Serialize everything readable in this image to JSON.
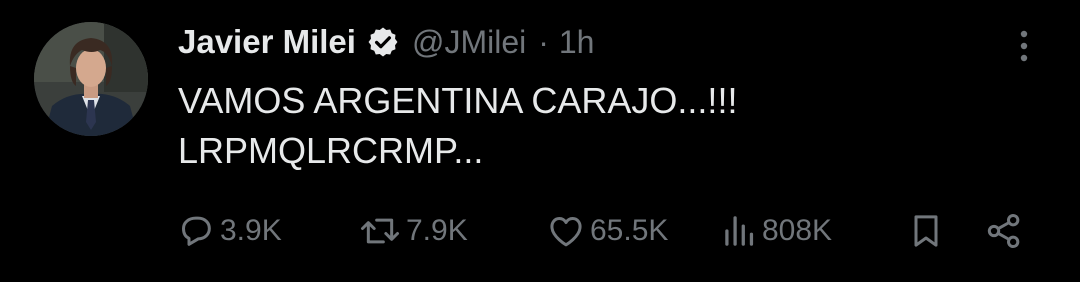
{
  "author": {
    "name": "Javier Milei",
    "handle": "@JMilei",
    "separator": "·",
    "time": "1h",
    "verified": true
  },
  "tweet": {
    "lines": [
      "VAMOS ARGENTINA CARAJO...!!!",
      "LRPMQLRCRMP..."
    ]
  },
  "actions": {
    "replies": "3.9K",
    "reposts": "7.9K",
    "likes": "65.5K",
    "views": "808K"
  },
  "icons": {
    "more": "more-vertical-icon",
    "reply": "reply-icon",
    "repost": "repost-icon",
    "like": "heart-icon",
    "views": "bar-chart-icon",
    "bookmark": "bookmark-icon",
    "share": "share-icon",
    "verified": "verified-badge-icon"
  },
  "colors": {
    "background": "#000000",
    "text_primary": "#e7e9ea",
    "text_secondary": "#71767b"
  }
}
